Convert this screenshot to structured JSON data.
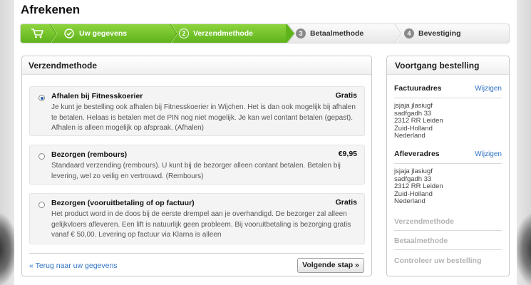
{
  "page": {
    "title": "Afrekenen"
  },
  "steps": [
    {
      "label": "Uw gegevens",
      "num": "",
      "state": "done"
    },
    {
      "label": "Verzendmethode",
      "num": "2",
      "state": "active"
    },
    {
      "label": "Betaalmethode",
      "num": "3",
      "state": "inactive"
    },
    {
      "label": "Bevestiging",
      "num": "4",
      "state": "inactive"
    }
  ],
  "main": {
    "header": "Verzendmethode",
    "options": [
      {
        "title": "Afhalen bij Fitnesskoerier",
        "price": "Gratis",
        "selected": true,
        "description": "Je kunt je bestelling ook afhalen bij Fitnesskoerier in Wijchen. Het is dan ook mogelijk bij afhalen te betalen. Helaas is betalen met de PIN nog niet mogelijk. Je kan wel contant betalen (gepast). Afhalen is alleen mogelijk op afspraak. (Afhalen)"
      },
      {
        "title": "Bezorgen (rembours)",
        "price": "€9,95",
        "selected": false,
        "description": "Standaard verzending (rembours). U kunt bij de bezorger alleen contant betalen. Betalen bij levering, wel zo veilig en vertrouwd. (Rembours)"
      },
      {
        "title": "Bezorgen (vooruitbetaling of op factuur)",
        "price": "Gratis",
        "selected": false,
        "description": "Het product word in de doos bij de eerste drempel aan je overhandigd. De bezorger zal alleen gelijkvloers afleveren. Een lift is natuurlijk geen probleem. Bij vooruitbetaling is bezorging gratis vanaf € 50,00. Levering op factuur via Klarna is alleen"
      }
    ],
    "back_link": "« Terug naar uw gegevens",
    "next_button": "Volgende stap »"
  },
  "sidebar": {
    "header": "Voortgang bestelling",
    "invoice_title": "Factuuradres",
    "invoice_edit": "Wijzigen",
    "invoice_lines": [
      "jsjaja jlasiugf",
      "sadfgadh 33",
      "2312 RR Leiden",
      "Zuid-Holland",
      "Nederland"
    ],
    "delivery_title": "Afleveradres",
    "delivery_edit": "Wijzigen",
    "delivery_lines": [
      "jsjaja jlasiugf",
      "sadfgadh 33",
      "2312 RR Leiden",
      "Zuid-Holland",
      "Nederland"
    ],
    "shipping_method": "Verzendmethode",
    "payment_method": "Betaalmethode",
    "review_order": "Controleer uw bestelling"
  },
  "colors": {
    "accent_green": "#6cc02a",
    "link_blue": "#2f73c4"
  },
  "icons": [
    "cart-icon",
    "check-circle-icon"
  ]
}
